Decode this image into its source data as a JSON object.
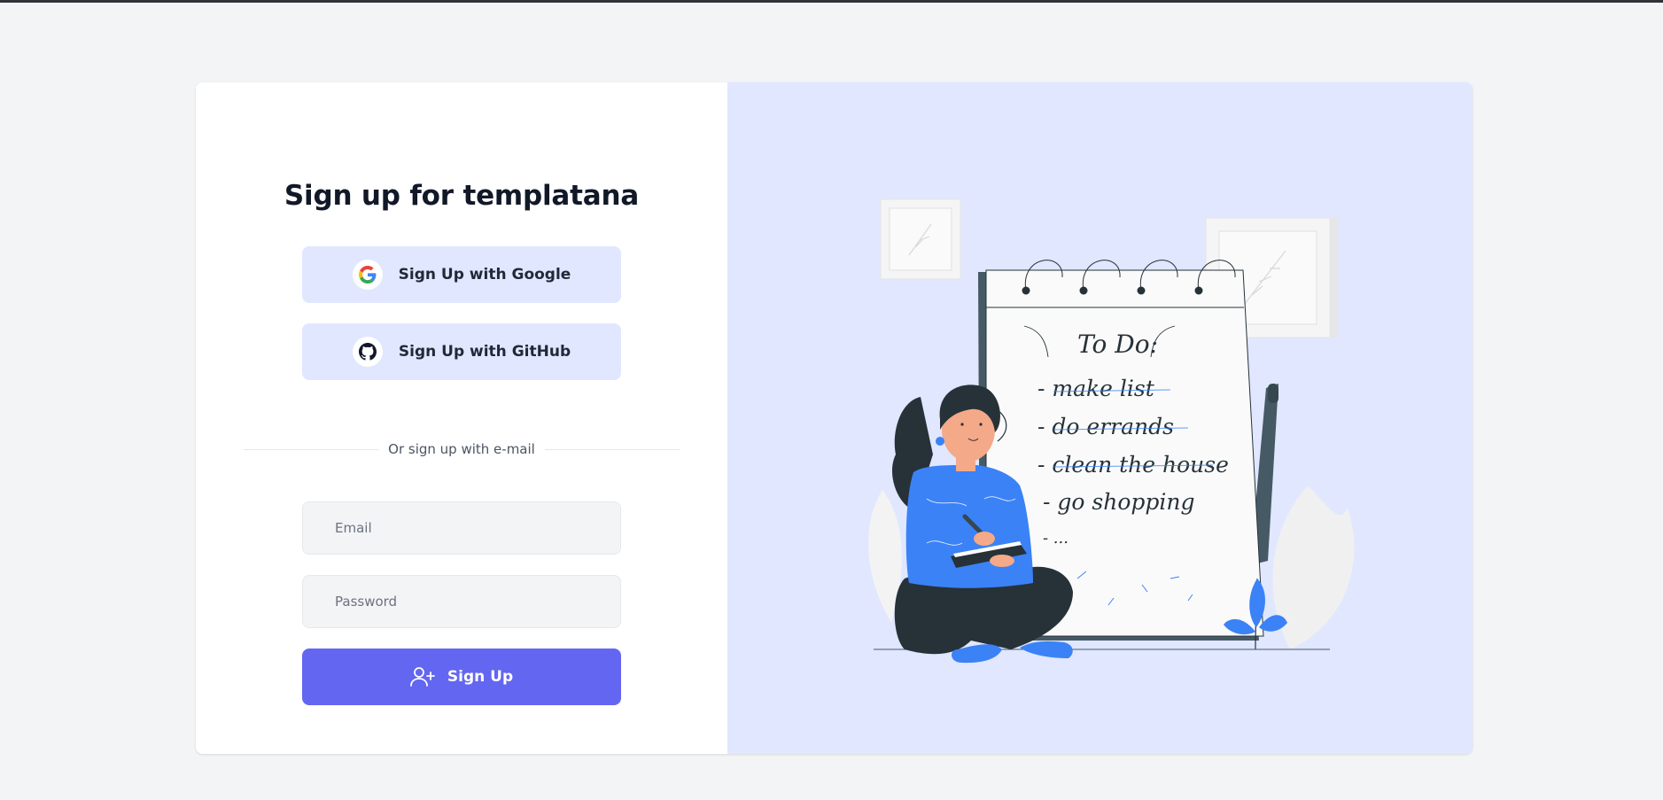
{
  "page": {
    "title": "Sign up for templatana"
  },
  "oauth": {
    "google_label": "Sign Up with Google",
    "github_label": "Sign Up with GitHub"
  },
  "divider": {
    "text": "Or sign up with e-mail"
  },
  "form": {
    "email_placeholder": "Email",
    "email_value": "",
    "password_placeholder": "Password",
    "password_value": "",
    "submit_label": "Sign Up"
  },
  "illustration": {
    "notepad_heading": "To Do:",
    "items": [
      "- make list",
      "- do errands",
      "- clean the house",
      "- go shopping",
      "- ..."
    ]
  },
  "icons": {
    "google": "google-logo-icon",
    "github": "github-logo-icon",
    "submit": "user-plus-icon"
  },
  "colors": {
    "accent": "#6366f1",
    "button_bg": "#e0e7ff",
    "panel_bg": "#e0e7ff",
    "page_bg": "#f3f4f6",
    "illustration_blue": "#3b82f6"
  }
}
